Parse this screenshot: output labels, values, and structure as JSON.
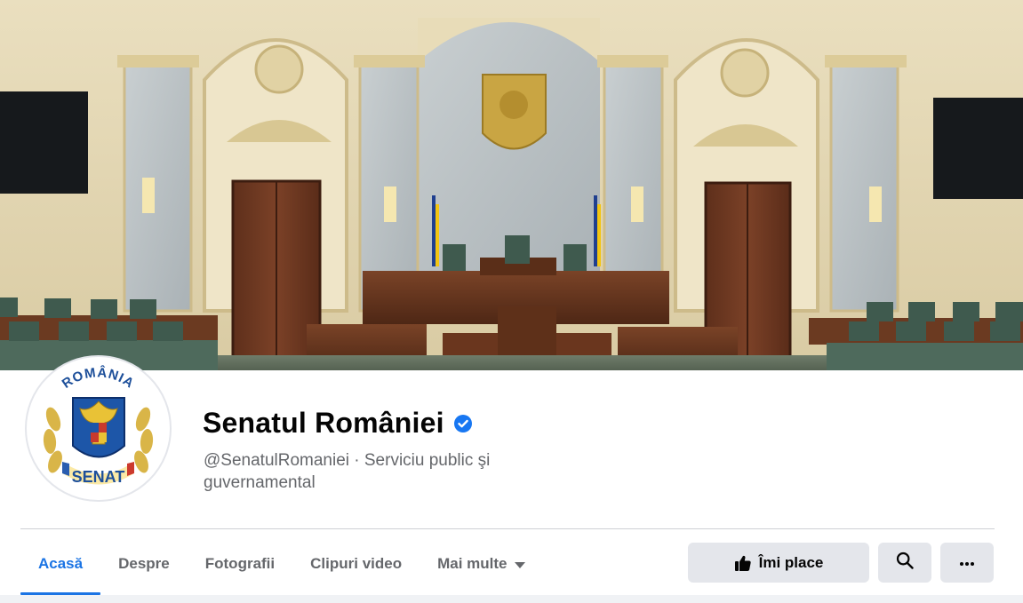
{
  "page": {
    "name": "Senatul României",
    "subtitle": "@SenatulRomaniei · Serviciu public şi guvernamental",
    "verified": true
  },
  "avatar": {
    "top_text": "ROMÂNIA",
    "bottom_text": "SENAT"
  },
  "tabs": [
    {
      "label": "Acasă",
      "active": true
    },
    {
      "label": "Despre",
      "active": false
    },
    {
      "label": "Fotografii",
      "active": false
    },
    {
      "label": "Clipuri video",
      "active": false
    },
    {
      "label": "Mai multe",
      "active": false,
      "has_dropdown": true
    }
  ],
  "actions": {
    "like_label": "Îmi place",
    "like_icon": "thumbs-up-icon",
    "search_icon": "search-icon",
    "more_icon": "more-horizontal-icon"
  },
  "colors": {
    "accent": "#1b74e4",
    "secondary_text": "#65676b",
    "button_bg": "#e4e6eb",
    "verified": "#1877f2"
  }
}
